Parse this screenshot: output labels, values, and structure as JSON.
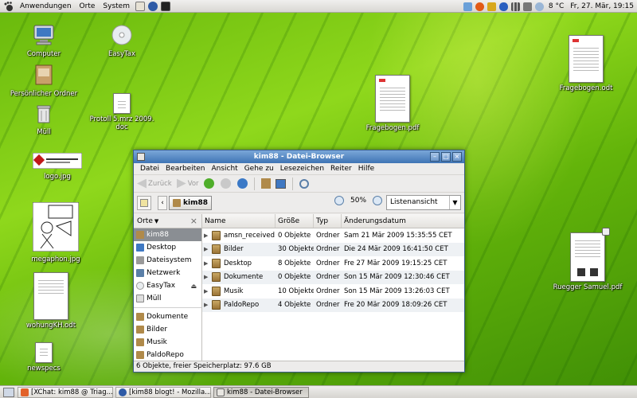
{
  "top_panel": {
    "menus": [
      "Anwendungen",
      "Orte",
      "System"
    ],
    "temperature": "8 °C",
    "clock": "Fr, 27. Mär, 19:15"
  },
  "desktop_icons": {
    "computer": "Computer",
    "easytax": "EasyTax",
    "home": "Persönlicher Ordner",
    "protocol": "Protoll 5.mrz 2009.\ndoc",
    "trash": "Müll",
    "fragebogen_pdf": "Fragebogen.pdf",
    "fragebogen_odt": "Fragebogen.odt",
    "logo": "logo.jpg",
    "megaphon": "megaphon.jpg",
    "wohung": "wohungKH.odt",
    "newspecs": "newspecs",
    "ruegger": "Ruegger Samuel.pdf"
  },
  "window": {
    "title": "kim88 - Datei-Browser",
    "menu": [
      "Datei",
      "Bearbeiten",
      "Ansicht",
      "Gehe zu",
      "Lesezeichen",
      "Reiter",
      "Hilfe"
    ],
    "toolbar": {
      "back": "Zurück",
      "forward": "Vor"
    },
    "location": {
      "crumb": "kim88",
      "zoom": "50%",
      "view": "Listenansicht"
    },
    "sidebar": {
      "header": "Orte",
      "items": [
        "kim88",
        "Desktop",
        "Dateisystem",
        "Netzwerk",
        "EasyTax",
        "Müll"
      ],
      "bookmarks": [
        "Dokumente",
        "Bilder",
        "Musik",
        "PaldoRepo"
      ]
    },
    "list": {
      "columns": [
        "Name",
        "Größe",
        "Typ",
        "Änderungsdatum"
      ],
      "rows": [
        {
          "name": "amsn_received",
          "size": "0 Objekte",
          "type": "Ordner",
          "date": "Sam 21 Mär 2009 15:35:55 CET"
        },
        {
          "name": "Bilder",
          "size": "30 Objekte",
          "type": "Ordner",
          "date": "Die 24 Mär 2009 16:41:50 CET"
        },
        {
          "name": "Desktop",
          "size": "8 Objekte",
          "type": "Ordner",
          "date": "Fre 27 Mär 2009 19:15:25 CET"
        },
        {
          "name": "Dokumente",
          "size": "0 Objekte",
          "type": "Ordner",
          "date": "Son 15 Mär 2009 12:30:46 CET"
        },
        {
          "name": "Musik",
          "size": "10 Objekte",
          "type": "Ordner",
          "date": "Son 15 Mär 2009 13:26:03 CET"
        },
        {
          "name": "PaldoRepo",
          "size": "4 Objekte",
          "type": "Ordner",
          "date": "Fre 20 Mär 2009 18:09:26 CET"
        }
      ]
    },
    "status": "6 Objekte, freier Speicherplatz: 97.6 GB"
  },
  "taskbar": {
    "tasks": [
      "[XChat: kim88 @ Triag...",
      "[kim88 blogt! - Mozilla...",
      "kim88 - Datei-Browser"
    ]
  },
  "colors": {
    "titlebar": "#3f74b5",
    "desktop": "#7cc816",
    "folder": "#b08a4a"
  }
}
